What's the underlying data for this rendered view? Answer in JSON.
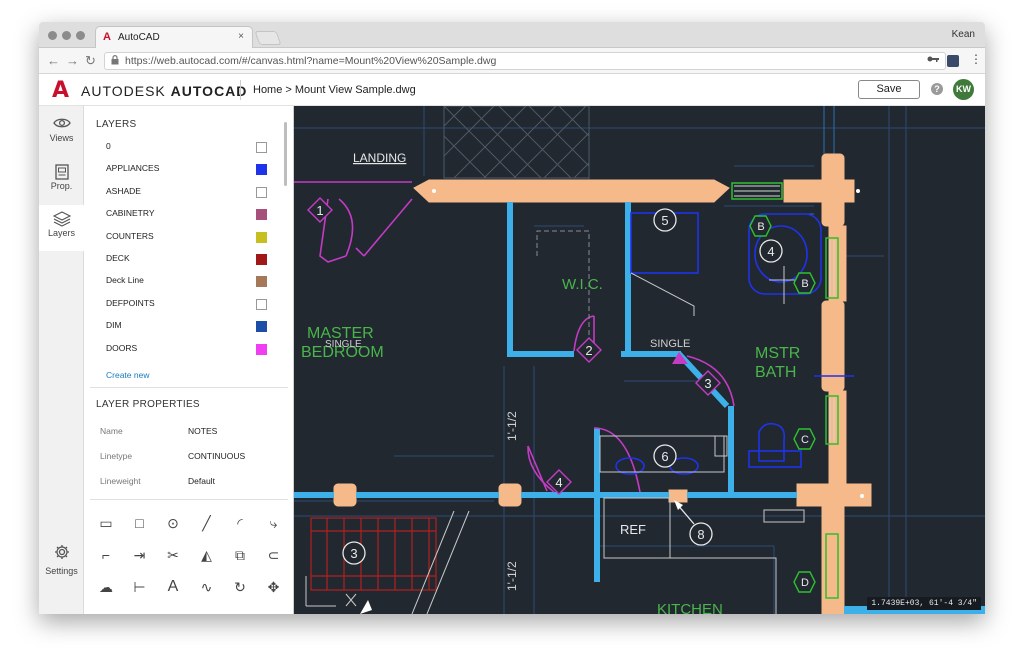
{
  "browser": {
    "tab_title": "AutoCAD",
    "tab_logo": "A",
    "tab_close": "×",
    "profile_name": "Kean",
    "url": "https://web.autocad.com/#/canvas.html?name=Mount%20View%20Sample.dwg",
    "back_glyph": "←",
    "forward_glyph": "→",
    "reload_glyph": "↻",
    "lock_glyph": "🔒",
    "key_glyph": "⚿",
    "menu_glyph": "⋮"
  },
  "header": {
    "logo_glyph": "A",
    "brand_light": "AUTODESK",
    "brand_bold": "AUTOCAD",
    "breadcrumb": "Home > Mount View Sample.dwg",
    "save_label": "Save",
    "help_glyph": "?",
    "avatar_initials": "KW"
  },
  "rail": {
    "views": "Views",
    "prop": "Prop.",
    "layers": "Layers",
    "settings": "Settings"
  },
  "layers": {
    "title": "LAYERS",
    "items": [
      {
        "name": "0",
        "color": "#ffffff"
      },
      {
        "name": "APPLIANCES",
        "color": "#1f33ea"
      },
      {
        "name": "ASHADE",
        "color": "#ffffff"
      },
      {
        "name": "CABINETRY",
        "color": "#a6507c"
      },
      {
        "name": "COUNTERS",
        "color": "#c7be1f"
      },
      {
        "name": "DECK",
        "color": "#a01818"
      },
      {
        "name": "Deck Line",
        "color": "#a5785a"
      },
      {
        "name": "DEFPOINTS",
        "color": "#ffffff"
      },
      {
        "name": "DIM",
        "color": "#1b4ea8"
      },
      {
        "name": "DOORS",
        "color": "#f03ff0"
      }
    ],
    "create_new": "Create new"
  },
  "properties": {
    "title": "LAYER PROPERTIES",
    "rows": [
      {
        "key": "Name",
        "value": "NOTES"
      },
      {
        "key": "Linetype",
        "value": "CONTINUOUS"
      },
      {
        "key": "Lineweight",
        "value": "Default"
      }
    ]
  },
  "tools": [
    "ruler",
    "rectangle",
    "circle",
    "line",
    "arc",
    "polyline",
    "offset",
    "extend",
    "trim",
    "mirror",
    "copy",
    "fillet",
    "revision-cloud",
    "dimension",
    "text",
    "spline",
    "rotate",
    "move"
  ],
  "drawing": {
    "labels": {
      "landing": "LANDING",
      "wic": "W.I.C.",
      "master1": "MASTER",
      "master2": "BEDROOM",
      "single1": "SINGLE",
      "single2": "SINGLE",
      "mstr": "MSTR",
      "bath": "BATH",
      "ref": "REF",
      "kitchen": "KITCHEN",
      "dim1": "1'-1/2",
      "dim2": "1'-1/2"
    },
    "tags": [
      "1",
      "2",
      "3",
      "4",
      "5",
      "6",
      "8"
    ],
    "hexes": [
      "B",
      "B",
      "C",
      "D"
    ],
    "coord_readout": "1.7439E+03, 61'-4 3/4\""
  },
  "colors": {
    "canvas": "#212830",
    "wall": "#f5b98a",
    "wall_blue": "#3dafe9",
    "door": "#c43bc4",
    "text_green": "#4ab54a"
  }
}
